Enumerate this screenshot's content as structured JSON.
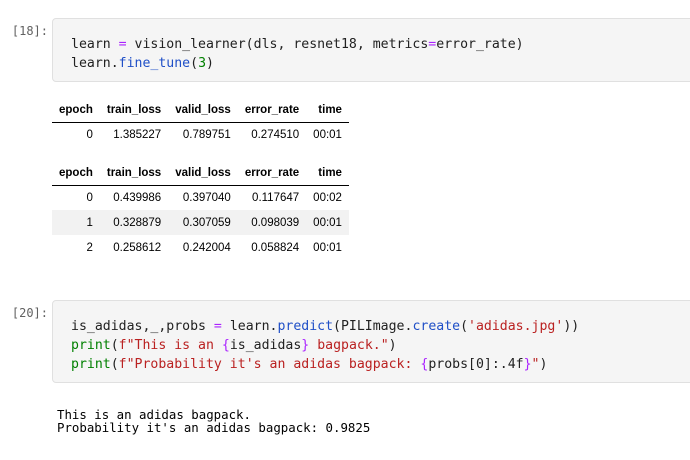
{
  "cells": [
    {
      "prompt": "[18]:",
      "code_lines": [
        [
          "learn ",
          "=",
          " vision_learner(dls, resnet18, metrics",
          "=",
          "error_rate)"
        ],
        [
          "learn.",
          "fine_tune",
          "(",
          "3",
          ")"
        ]
      ]
    },
    {
      "prompt": "[20]:",
      "code_lines": [
        [
          "is_adidas,_,probs ",
          "=",
          " learn.",
          "predict",
          "(PILImage.",
          "create",
          "(",
          "'adidas.jpg'",
          "))"
        ],
        [
          "print",
          "(",
          "f\"This is an ",
          "{",
          "is_adidas",
          "}",
          " bagpack.\"",
          ")"
        ],
        [
          "print",
          "(",
          "f\"Probability it's an adidas bagpack: ",
          "{",
          "probs[0]:.4f",
          "}",
          "\"",
          ")"
        ]
      ],
      "output_lines": [
        "This is an adidas bagpack.",
        "Probability it's an adidas bagpack: 0.9825"
      ]
    }
  ],
  "tables": [
    {
      "headers": [
        "epoch",
        "train_loss",
        "valid_loss",
        "error_rate",
        "time"
      ],
      "rows": [
        [
          "0",
          "1.385227",
          "0.789751",
          "0.274510",
          "00:01"
        ]
      ]
    },
    {
      "headers": [
        "epoch",
        "train_loss",
        "valid_loss",
        "error_rate",
        "time"
      ],
      "rows": [
        [
          "0",
          "0.439986",
          "0.397040",
          "0.117647",
          "00:02"
        ],
        [
          "1",
          "0.328879",
          "0.307059",
          "0.098039",
          "00:01"
        ],
        [
          "2",
          "0.258612",
          "0.242004",
          "0.058824",
          "00:01"
        ]
      ]
    }
  ]
}
